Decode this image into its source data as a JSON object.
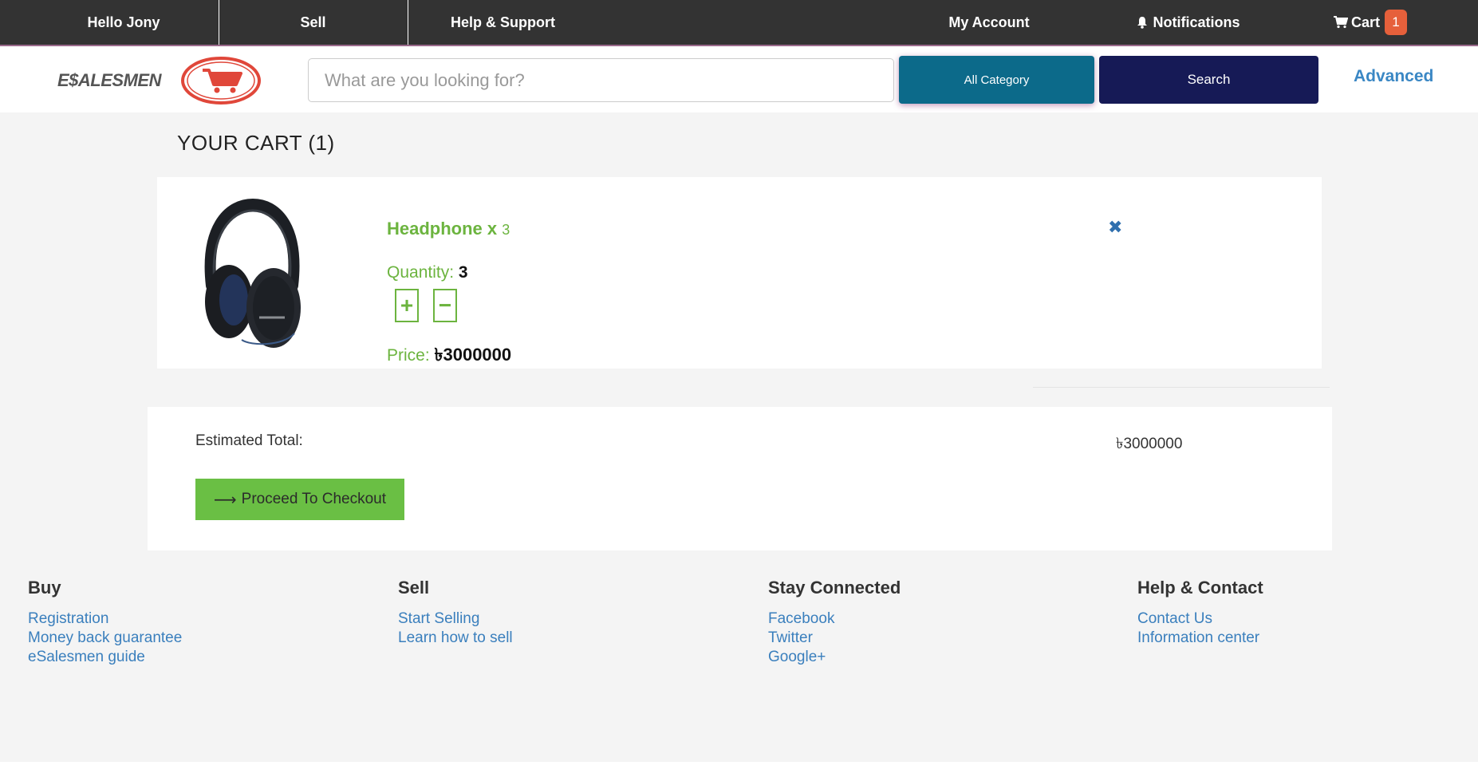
{
  "topbar": {
    "greeting": "Hello Jony",
    "sell": "Sell",
    "help": "Help & Support",
    "account": "My Account",
    "notifications": "Notifications",
    "cart_label": "Cart",
    "cart_count": "1"
  },
  "header": {
    "logo_text": "E$ALESMEN",
    "search_placeholder": "What are you looking for?",
    "search_value": "",
    "category_label": "All Category",
    "search_button": "Search",
    "advanced_link": "Advanced"
  },
  "cart": {
    "title": "YOUR CART (1)",
    "items": [
      {
        "name": "Headphone x",
        "multiplier": "3",
        "quantity_label": "Quantity:",
        "quantity": "3",
        "price_label": "Price:",
        "price": "৳3000000",
        "image_icon": "headphone-image"
      }
    ],
    "plus_glyph": "+",
    "minus_glyph": "−",
    "remove_glyph": "✖"
  },
  "totals": {
    "label": "Estimated Total:",
    "value": "৳3000000",
    "checkout_label": "Proceed To Checkout"
  },
  "footer": {
    "columns": [
      {
        "heading": "Buy",
        "links": [
          "Registration",
          "Money back guarantee",
          "eSalesmen guide"
        ]
      },
      {
        "heading": "Sell",
        "links": [
          "Start Selling",
          "Learn how to sell"
        ]
      },
      {
        "heading": "Stay Connected",
        "links": [
          "Facebook",
          "Twitter",
          "Google+"
        ]
      },
      {
        "heading": "Help & Contact",
        "links": [
          "Contact Us",
          "Information center"
        ]
      }
    ]
  },
  "colors": {
    "topbar_bg": "#333333",
    "accent_green": "#6cb43f",
    "category_btn": "#0c6a8a",
    "search_btn": "#161a56",
    "badge": "#e6603b",
    "link_blue": "#3a7fbd"
  }
}
